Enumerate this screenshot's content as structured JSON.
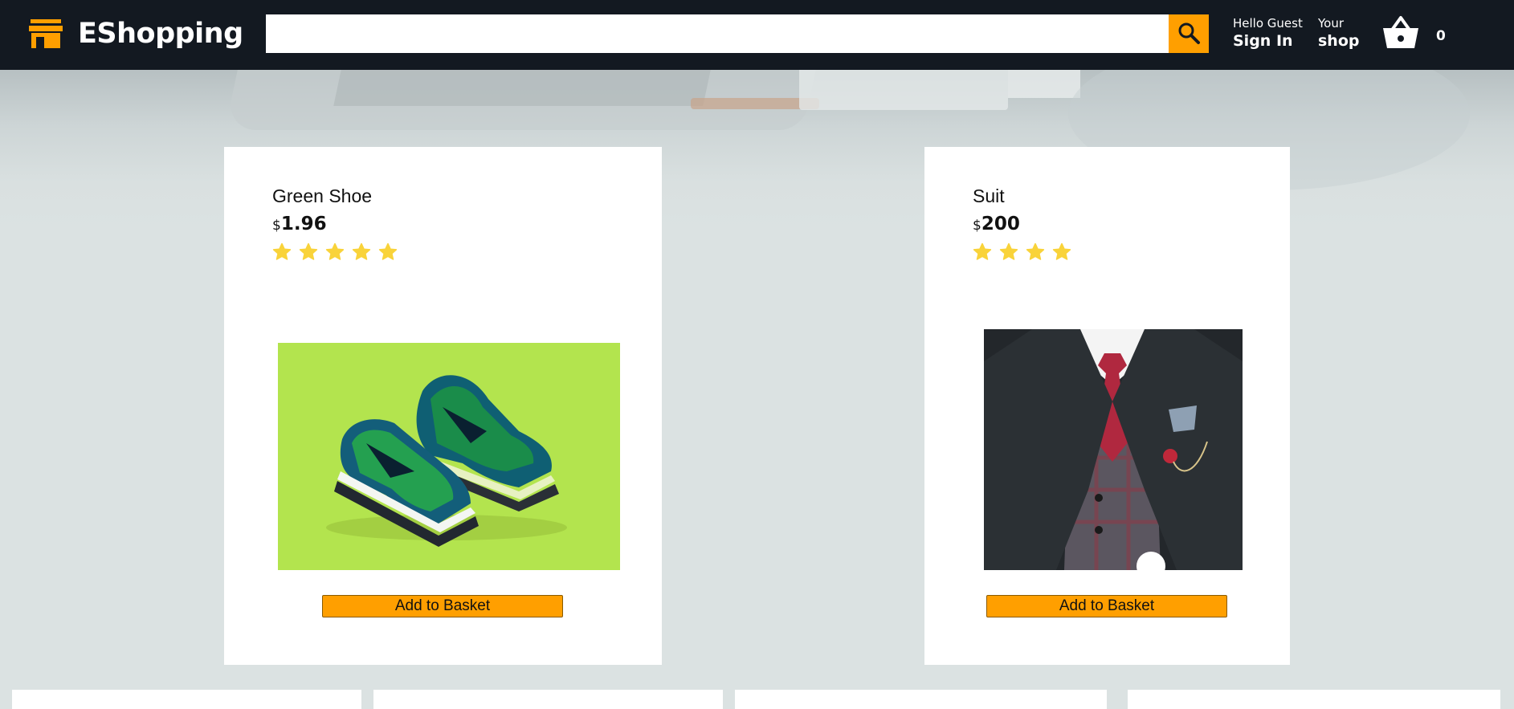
{
  "header": {
    "brand": "EShopping",
    "search": {
      "value": "",
      "placeholder": ""
    },
    "signin": {
      "line1": "Hello Guest",
      "line2": "Sign In"
    },
    "shop": {
      "line1": "Your",
      "line2": "shop"
    },
    "basket_count": "0",
    "icons": [
      "storefront-icon",
      "search-icon",
      "basket-icon"
    ]
  },
  "colors": {
    "header_bg": "#131921",
    "accent": "#ff9f00",
    "page_bg": "#dbe2e2",
    "star": "#f9d33a"
  },
  "products": [
    {
      "title": "Green Shoe",
      "price_symbol": "$",
      "price": "1.96",
      "rating": 5,
      "image": "green sneakers on lime background",
      "button": "Add to Basket"
    },
    {
      "title": "Suit",
      "price_symbol": "$",
      "price": "200",
      "rating": 4,
      "image": "man in dark suit with red tie",
      "button": "Add to Basket"
    }
  ]
}
